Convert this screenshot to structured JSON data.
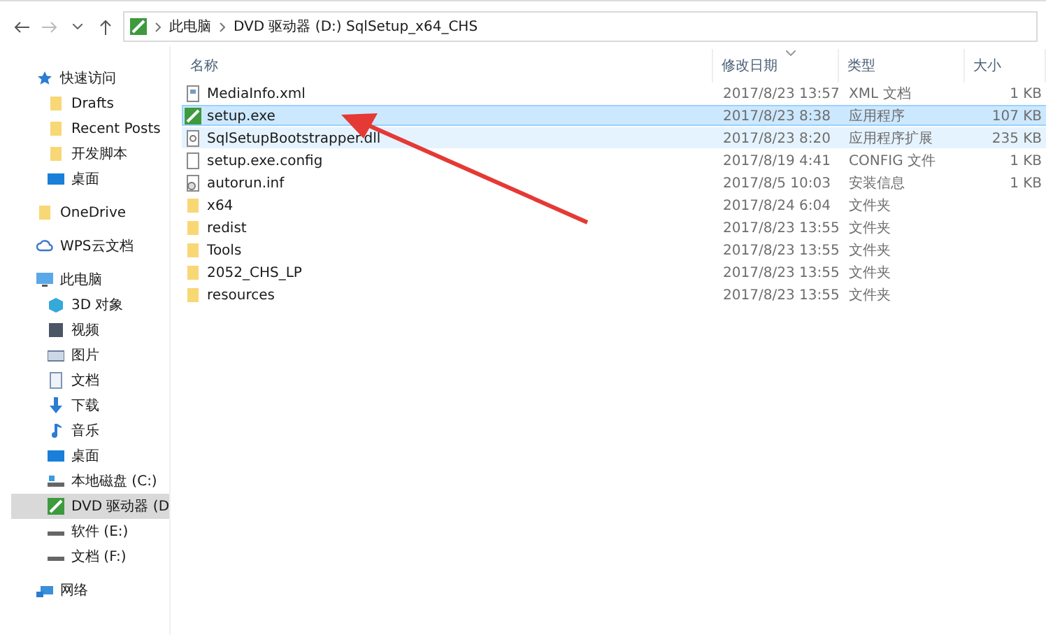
{
  "address_bar": {
    "path": [
      {
        "label": "此电脑"
      },
      {
        "label": "DVD 驱动器 (D:) SqlSetup_x64_CHS"
      }
    ]
  },
  "sidebar": {
    "groups": [
      {
        "label": "快速访问",
        "kind": "star",
        "selected": false,
        "children": [
          {
            "label": "Drafts",
            "kind": "folder",
            "selected": false
          },
          {
            "label": "Recent Posts",
            "kind": "folder",
            "selected": false
          },
          {
            "label": "开发脚本",
            "kind": "folder",
            "selected": false
          },
          {
            "label": "桌面",
            "kind": "desktop",
            "selected": false
          }
        ]
      },
      {
        "label": "OneDrive",
        "kind": "folder",
        "selected": false
      },
      {
        "label": "WPS云文档",
        "kind": "cloud",
        "selected": false
      },
      {
        "label": "此电脑",
        "kind": "pc",
        "selected": false,
        "children": [
          {
            "label": "3D 对象",
            "kind": "cube",
            "selected": false
          },
          {
            "label": "视频",
            "kind": "video",
            "selected": false
          },
          {
            "label": "图片",
            "kind": "picture",
            "selected": false
          },
          {
            "label": "文档",
            "kind": "doc",
            "selected": false
          },
          {
            "label": "下载",
            "kind": "download",
            "selected": false
          },
          {
            "label": "音乐",
            "kind": "music",
            "selected": false
          },
          {
            "label": "桌面",
            "kind": "desktop",
            "selected": false
          },
          {
            "label": "本地磁盘 (C:)",
            "kind": "sysdrive",
            "selected": false
          },
          {
            "label": "DVD 驱动器 (D",
            "kind": "dvd",
            "selected": true
          },
          {
            "label": "软件 (E:)",
            "kind": "drive",
            "selected": false
          },
          {
            "label": "文档 (F:)",
            "kind": "drive",
            "selected": false
          }
        ]
      },
      {
        "label": "网络",
        "kind": "network",
        "selected": false
      }
    ]
  },
  "file_list": {
    "columns": [
      {
        "label": "名称",
        "sorted": false
      },
      {
        "label": "修改日期",
        "sorted": true
      },
      {
        "label": "类型",
        "sorted": false
      },
      {
        "label": "大小",
        "sorted": false
      }
    ],
    "rows": [
      {
        "name": "MediaInfo.xml",
        "kind": "xml",
        "date": "2017/8/23 13:57",
        "type": "XML 文档",
        "size": "1 KB",
        "selected": false,
        "hover": false
      },
      {
        "name": "setup.exe",
        "kind": "exe",
        "date": "2017/8/23 8:38",
        "type": "应用程序",
        "size": "107 KB",
        "selected": true,
        "hover": false
      },
      {
        "name": "SqlSetupBootstrapper.dll",
        "kind": "dll",
        "date": "2017/8/23 8:20",
        "type": "应用程序扩展",
        "size": "235 KB",
        "selected": false,
        "hover": true
      },
      {
        "name": "setup.exe.config",
        "kind": "file",
        "date": "2017/8/19 4:41",
        "type": "CONFIG 文件",
        "size": "1 KB",
        "selected": false,
        "hover": false
      },
      {
        "name": "autorun.inf",
        "kind": "inf",
        "date": "2017/8/5 10:03",
        "type": "安装信息",
        "size": "1 KB",
        "selected": false,
        "hover": false
      },
      {
        "name": "x64",
        "kind": "folder",
        "date": "2017/8/24 6:04",
        "type": "文件夹",
        "selected": false,
        "hover": false
      },
      {
        "name": "redist",
        "kind": "folder",
        "date": "2017/8/23 13:55",
        "type": "文件夹",
        "selected": false,
        "hover": false
      },
      {
        "name": "Tools",
        "kind": "folder",
        "date": "2017/8/23 13:55",
        "type": "文件夹",
        "selected": false,
        "hover": false
      },
      {
        "name": "2052_CHS_LP",
        "kind": "folder",
        "date": "2017/8/23 13:55",
        "type": "文件夹",
        "selected": false,
        "hover": false
      },
      {
        "name": "resources",
        "kind": "folder",
        "date": "2017/8/23 13:55",
        "type": "文件夹",
        "selected": false,
        "hover": false
      }
    ]
  }
}
